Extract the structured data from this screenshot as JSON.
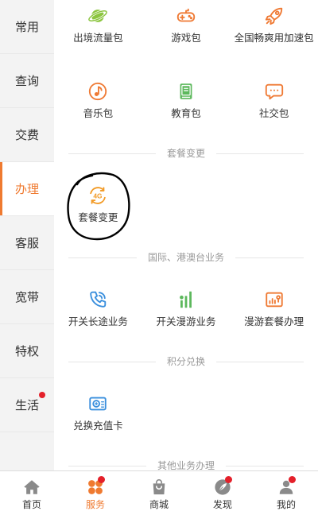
{
  "colors": {
    "accent": "#ef7a30",
    "badge": "#e4202a",
    "sidebar_bg": "#f3f3f3",
    "text": "#333333",
    "muted": "#999999",
    "line": "#e6e6e6",
    "tab_icon": "#8a8a8a",
    "annotation": "#000000"
  },
  "sidebar": {
    "items": [
      {
        "label": "常用",
        "active": false,
        "badge": false
      },
      {
        "label": "查询",
        "active": false,
        "badge": false
      },
      {
        "label": "交费",
        "active": false,
        "badge": false
      },
      {
        "label": "办理",
        "active": true,
        "badge": false
      },
      {
        "label": "客服",
        "active": false,
        "badge": false
      },
      {
        "label": "宽带",
        "active": false,
        "badge": false
      },
      {
        "label": "特权",
        "active": false,
        "badge": false
      },
      {
        "label": "生活",
        "active": false,
        "badge": true
      }
    ]
  },
  "main": {
    "packages": {
      "items": [
        {
          "label": "出境流量包",
          "icon": "planet-icon",
          "color": "#8cc540"
        },
        {
          "label": "游戏包",
          "icon": "gamepad-icon",
          "color": "#ef7a34"
        },
        {
          "label": "全国畅爽用加速包",
          "icon": "rocket-icon",
          "color": "#ef7a34"
        },
        {
          "label": "音乐包",
          "icon": "music-note-icon",
          "color": "#ef7a34"
        },
        {
          "label": "教育包",
          "icon": "book-icon",
          "color": "#5cb85c"
        },
        {
          "label": "社交包",
          "icon": "chat-bubble-icon",
          "color": "#ef7a34"
        }
      ]
    },
    "plan_change": {
      "title": "套餐变更",
      "items": [
        {
          "label": "套餐变更",
          "icon": "4g-refresh-icon",
          "icon_text": "4G",
          "color": "#f29b27"
        }
      ]
    },
    "international": {
      "title": "国际、港澳台业务",
      "items": [
        {
          "label": "开关长途业务",
          "icon": "phone-call-icon",
          "color": "#3a8fdd"
        },
        {
          "label": "开关漫游业务",
          "icon": "signal-bars-icon",
          "color": "#5cb85c"
        },
        {
          "label": "漫游套餐办理",
          "icon": "roaming-card-icon",
          "color": "#ef7a34"
        }
      ]
    },
    "points": {
      "title": "积分兑换",
      "items": [
        {
          "label": "兑换充值卡",
          "icon": "recharge-card-icon",
          "color": "#3a8fdd"
        }
      ]
    },
    "other": {
      "title": "其他业务办理"
    }
  },
  "tabbar": {
    "items": [
      {
        "label": "首页",
        "icon": "home-icon",
        "active": false,
        "badge": false
      },
      {
        "label": "服务",
        "icon": "service-icon",
        "active": true,
        "badge": true
      },
      {
        "label": "商城",
        "icon": "shopping-bag-icon",
        "active": false,
        "badge": false
      },
      {
        "label": "发现",
        "icon": "discover-icon",
        "active": false,
        "badge": true
      },
      {
        "label": "我的",
        "icon": "person-icon",
        "active": false,
        "badge": true
      }
    ]
  }
}
